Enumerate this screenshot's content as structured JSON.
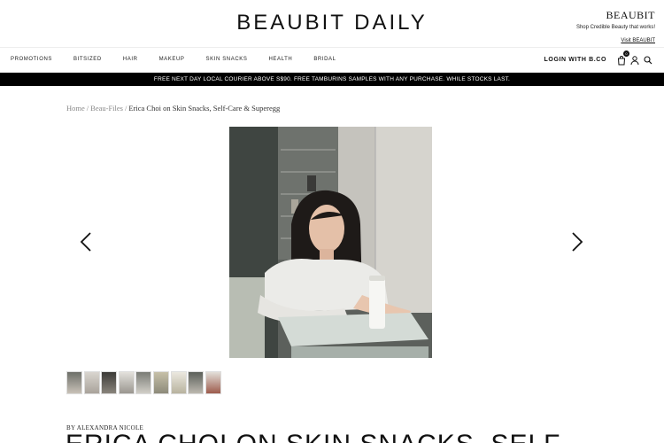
{
  "header": {
    "logo": "BEAUBIT DAILY",
    "promo": {
      "brand": "BEAUBIT",
      "tagline": "Shop Credible Beauty that works!",
      "link": "Visit BEAUBIT"
    }
  },
  "nav": {
    "items": [
      "PROMOTIONS",
      "BITSIZED",
      "HAIR",
      "MAKEUP",
      "SKIN SNACKS",
      "HEALTH",
      "BRIDAL"
    ],
    "login": "LOGIN WITH B.CO",
    "bag_count": "0"
  },
  "announcement": "FREE NEXT DAY LOCAL COURIER ABOVE S$90. FREE TAMBURINS SAMPLES WITH ANY PURCHASE. WHILE STOCKS LAST.",
  "breadcrumb": {
    "items": [
      "Home",
      "Beau-Files"
    ],
    "current": "Erica Choi on Skin Snacks, Self-Care & Superegg"
  },
  "article": {
    "byline": "BY ALEXANDRA NICOLE",
    "title": "ERICA CHOI ON SKIN SNACKS, SELF"
  },
  "gallery": {
    "thumb_count": 9
  }
}
